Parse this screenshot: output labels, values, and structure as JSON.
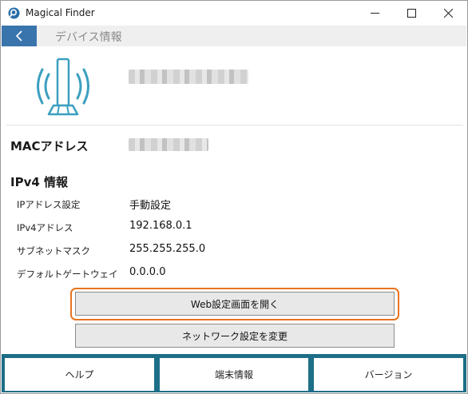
{
  "window": {
    "title": "Magical Finder",
    "controls": [
      "minimize-icon",
      "maximize-icon",
      "close-icon"
    ]
  },
  "header": {
    "back_label": "<",
    "title": "デバイス情報"
  },
  "device": {
    "icon": "wifi-router-icon"
  },
  "mac": {
    "label": "MACアドレス"
  },
  "ipv4": {
    "heading": "IPv4 情報",
    "rows": [
      {
        "label": "IPアドレス設定",
        "value": "手動設定"
      },
      {
        "label": "IPv4アドレス",
        "value": "192.168.0.1"
      },
      {
        "label": "サブネットマスク",
        "value": "255.255.255.0"
      },
      {
        "label": "デフォルトゲートウェイ",
        "value": "0.0.0.0"
      }
    ]
  },
  "actions": {
    "web_settings": "Web設定画面を開く",
    "network_settings": "ネットワーク設定を変更"
  },
  "nav": {
    "help": "ヘルプ",
    "device_info": "端末情報",
    "version": "バージョン"
  },
  "colors": {
    "accent_blue": "#3a74ad",
    "nav_teal": "#1d6e87",
    "highlight_orange": "#e8741f",
    "icon_teal": "#3b9fbf"
  }
}
